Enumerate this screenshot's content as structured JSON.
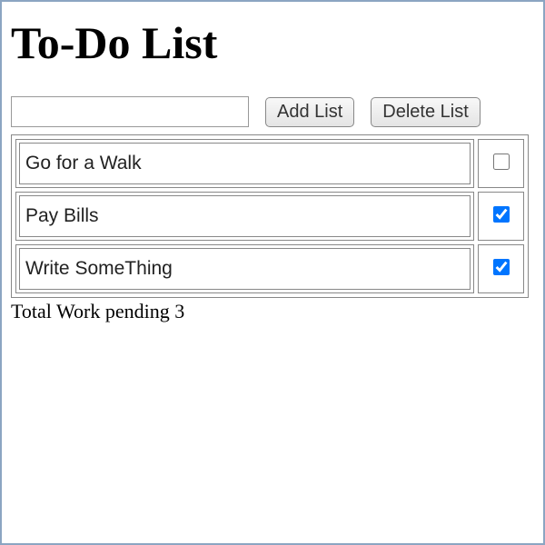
{
  "title": "To-Do List",
  "controls": {
    "input_value": "",
    "add_label": "Add List",
    "delete_label": "Delete List"
  },
  "tasks": [
    {
      "label": "Go for a Walk",
      "checked": false
    },
    {
      "label": " Pay Bills",
      "checked": true
    },
    {
      "label": "Write SomeThing",
      "checked": true
    }
  ],
  "status": {
    "prefix": "Total Work pending ",
    "count": 3
  }
}
